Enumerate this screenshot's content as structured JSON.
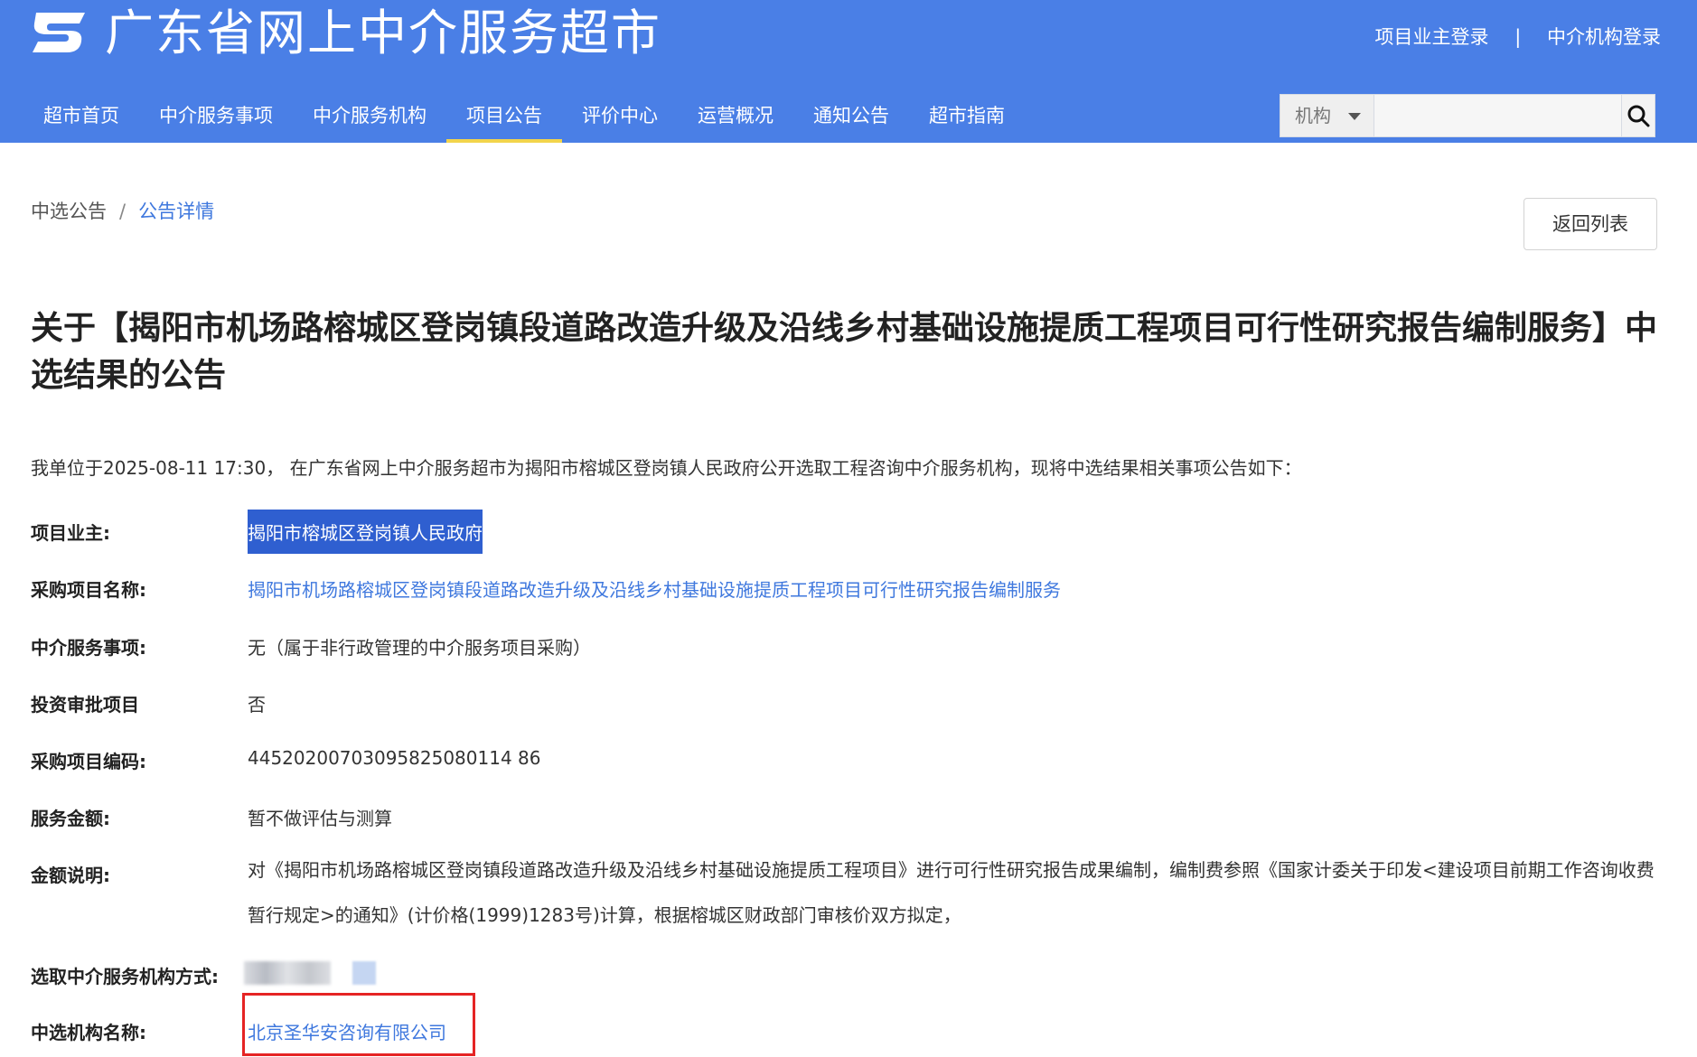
{
  "header": {
    "site_title": "广东省网上中介服务超市",
    "login_owner": "项目业主登录",
    "login_separator": "|",
    "login_agency": "中介机构登录",
    "brand_color": "#4a7fe6"
  },
  "nav": {
    "items": [
      {
        "label": "超市首页",
        "active": false
      },
      {
        "label": "中介服务事项",
        "active": false
      },
      {
        "label": "中介服务机构",
        "active": false
      },
      {
        "label": "项目公告",
        "active": true
      },
      {
        "label": "评价中心",
        "active": false
      },
      {
        "label": "运营概况",
        "active": false
      },
      {
        "label": "通知公告",
        "active": false
      },
      {
        "label": "超市指南",
        "active": false
      }
    ]
  },
  "search": {
    "select_value": "机构",
    "input_value": "",
    "icon": "search-icon"
  },
  "breadcrumb": {
    "parent": "中选公告",
    "separator": "/",
    "current": "公告详情"
  },
  "back_button": "返回列表",
  "title": "关于【揭阳市机场路榕城区登岗镇段道路改造升级及沿线乡村基础设施提质工程项目可行性研究报告编制服务】中选结果的公告",
  "intro": "我单位于2025-08-11 17:30， 在广东省网上中介服务超市为揭阳市榕城区登岗镇人民政府公开选取工程咨询中介服务机构，现将中选结果相关事项公告如下：",
  "details": {
    "owner_label": "项目业主:",
    "owner_value": "揭阳市榕城区登岗镇人民政府",
    "project_name_label": "采购项目名称:",
    "project_name_value": "揭阳市机场路榕城区登岗镇段道路改造升级及沿线乡村基础设施提质工程项目可行性研究报告编制服务",
    "service_item_label": "中介服务事项:",
    "service_item_value": "无（属于非行政管理的中介服务项目采购）",
    "investment_label": "投资审批项目",
    "investment_value": "否",
    "project_code_label": "采购项目编码:",
    "project_code_value": "44520200703095825080114 86",
    "amount_label": "服务金额:",
    "amount_value": "暂不做评估与测算",
    "amount_note_label": "金额说明:",
    "amount_note_value": "对《揭阳市机场路榕城区登岗镇段道路改造升级及沿线乡村基础设施提质工程项目》进行可行性研究报告成果编制，编制费参照《国家计委关于印发<建设项目前期工作咨询收费暂行规定>的通知》(计价格(1999)1283号)计算，根据榕城区财政部门审核价双方拟定，",
    "selection_method_label": "选取中介服务机构方式:",
    "winner_label": "中选机构名称:",
    "winner_value": "北京圣华安咨询有限公司"
  },
  "colors": {
    "link": "#3f78de",
    "highlight_bg": "#2f5fd0",
    "annotation_box": "#e52424",
    "active_tab_underline": "#f2d44b"
  }
}
